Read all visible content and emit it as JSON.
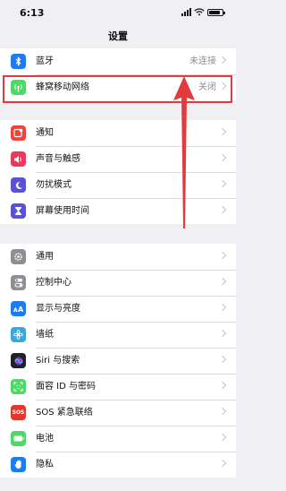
{
  "status": {
    "time": "6:13"
  },
  "nav": {
    "title": "设置"
  },
  "group1": [
    {
      "name": "bluetooth",
      "label": "蓝牙",
      "value": "未连接",
      "icon": "bluetooth-icon",
      "color": "#1e7cf2"
    },
    {
      "name": "cellular",
      "label": "蜂窝移动网络",
      "value": "关闭",
      "icon": "cellular-antenna-icon",
      "color": "#4cd964"
    }
  ],
  "group2": [
    {
      "name": "notifications",
      "label": "通知",
      "icon": "notifications-icon",
      "color": "#f2433a"
    },
    {
      "name": "sounds",
      "label": "声音与触感",
      "icon": "speaker-icon",
      "color": "#f0375b"
    },
    {
      "name": "do-not-disturb",
      "label": "勿扰模式",
      "icon": "moon-icon",
      "color": "#5a52d5"
    },
    {
      "name": "screen-time",
      "label": "屏幕使用时间",
      "icon": "hourglass-icon",
      "color": "#5a52d5"
    }
  ],
  "group3": [
    {
      "name": "general",
      "label": "通用",
      "icon": "gear-icon",
      "color": "#8e8e93"
    },
    {
      "name": "control-center",
      "label": "控制中心",
      "icon": "toggles-icon",
      "color": "#8e8e93"
    },
    {
      "name": "display",
      "label": "显示与亮度",
      "icon": "text-size-icon",
      "color": "#1e7cf2"
    },
    {
      "name": "wallpaper",
      "label": "墙纸",
      "icon": "flower-icon",
      "color": "#35aadc"
    },
    {
      "name": "siri",
      "label": "Siri 与搜索",
      "icon": "siri-icon",
      "color": "#222222"
    },
    {
      "name": "face-id",
      "label": "面容 ID 与密码",
      "icon": "face-id-icon",
      "color": "#4cd964"
    },
    {
      "name": "sos",
      "label": "SOS 紧急联络",
      "icon": "sos-icon",
      "color": "#e0382e",
      "icon_text": "SOS"
    },
    {
      "name": "battery",
      "label": "电池",
      "icon": "battery-icon",
      "color": "#4cd964"
    },
    {
      "name": "privacy",
      "label": "隐私",
      "icon": "hand-icon",
      "color": "#1e7cf2"
    }
  ],
  "colors": {
    "accent_red": "#e03c3f"
  }
}
